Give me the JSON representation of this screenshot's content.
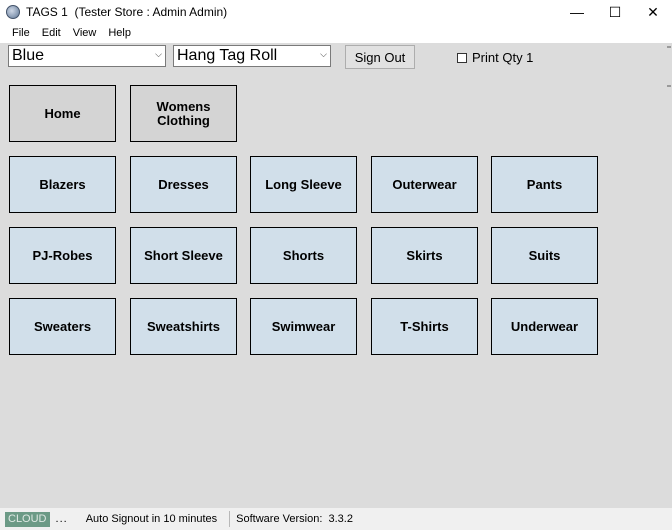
{
  "window": {
    "title": "TAGS 1  (Tester Store : Admin Admin)",
    "minimize_glyph": "—",
    "maximize_glyph": "☐",
    "close_glyph": "✕"
  },
  "menu": [
    "File",
    "Edit",
    "View",
    "Help"
  ],
  "toolbar": {
    "color_select_value": "Blue",
    "tag_type_select_value": "Hang Tag Roll",
    "sign_out_label": "Sign Out",
    "print_qty_label": "Print Qty 1",
    "print_qty_checked": false
  },
  "nav_buttons": [
    "Home",
    "Womens\nClothing"
  ],
  "categories": [
    "Blazers",
    "Dresses",
    "Long Sleeve",
    "Outerwear",
    "Pants",
    "PJ-Robes",
    "Short Sleeve",
    "Shorts",
    "Skirts",
    "Suits",
    "Sweaters",
    "Sweatshirts",
    "Swimwear",
    "T-Shirts",
    "Underwear"
  ],
  "status": {
    "cloud_label": "CLOUD",
    "dots": "...",
    "auto_signout": "Auto Signout in 10 minutes",
    "software_version": "Software Version:  3.3.2"
  },
  "colors": {
    "window_background": "#dcdcdc",
    "category_tile": "#d1dfea",
    "nav_tile": "#d4d4d4",
    "cloud_badge": "#6c9a86"
  }
}
